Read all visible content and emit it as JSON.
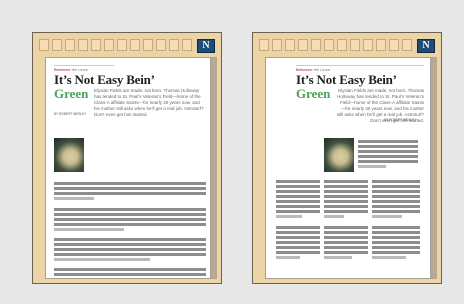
{
  "logo": "N",
  "left": {
    "section": "Between",
    "section_sub": "the Lines",
    "headline1": "It’s Not Easy Bein’",
    "headline2": "Green",
    "dek": "Elysian Fields are made, not born. Thomas Holloway has tended to St. Paul’s Veteran’s Field—home of the Class-A affiliate Saints—for nearly 30 years now, and his mother still asks when he’ll get a real job. Astroturf? Don’t even get him started.",
    "byline": "BY ROBERT WESLEY"
  },
  "right": {
    "section": "Between",
    "section_sub": "the Lines",
    "headline1": "It’s Not Easy Bein’",
    "headline2": "Green",
    "dek": "Elysian Fields are made, not born. Thomas Holloway has tended to St. Paul’s Veteran’s Field—home of the Class-A affiliate Saints—for nearly 30 years now, and his mother still asks when he’ll get a real job. Astroturf? Don’t even get him started.",
    "byline": "BY ROBERT WESLEY"
  }
}
